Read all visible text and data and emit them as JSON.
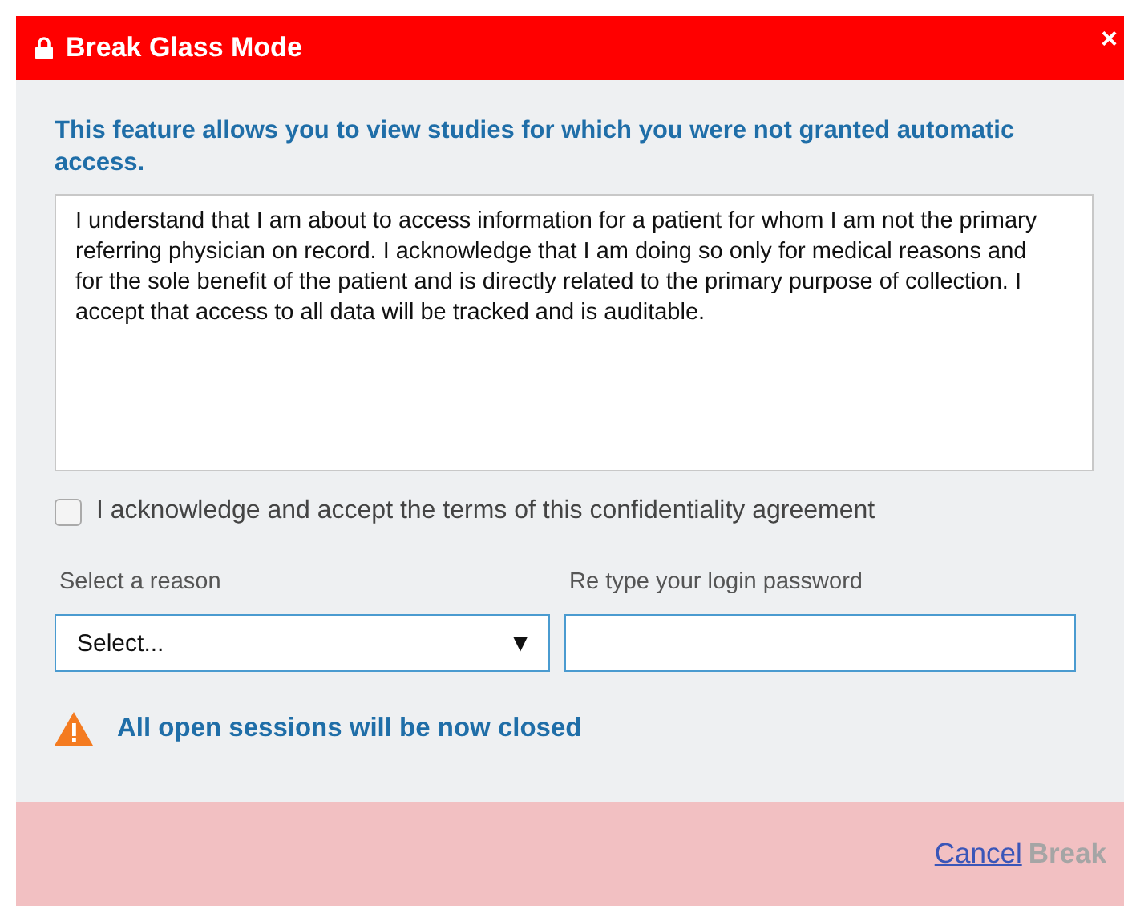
{
  "dialog": {
    "title": "Break Glass Mode",
    "close": "×",
    "intro": "This feature allows you to view studies for which you were not granted automatic access.",
    "agreement": "I understand that I am about to access information for a patient for whom I am not the primary referring physician on record. I acknowledge that I am doing so only for medical reasons and for the sole benefit of the patient and is directly related to the primary purpose of collection. I accept that access to all data will be tracked and is auditable.",
    "acknowledge": {
      "label": "I acknowledge and accept the terms of this confidentiality agreement",
      "checked": false
    },
    "reason": {
      "label": "Select a reason",
      "value": "Select...",
      "caret": "▼"
    },
    "password": {
      "label": "Re type your login password"
    },
    "warning": "All open sessions will be now closed",
    "buttons": [
      {
        "label": "Cancel",
        "kind": "link",
        "disabled": false
      },
      {
        "label": "Break",
        "kind": "link",
        "disabled": true
      }
    ]
  }
}
